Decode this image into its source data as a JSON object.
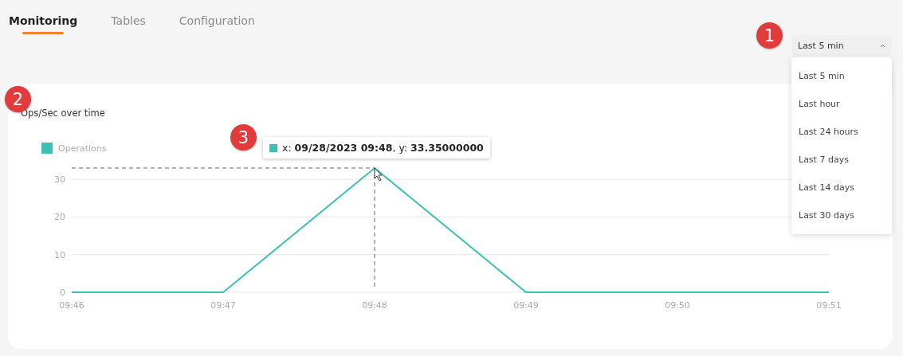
{
  "tabs": [
    {
      "label": "Monitoring",
      "selected": true
    },
    {
      "label": "Tables",
      "selected": false
    },
    {
      "label": "Configuration",
      "selected": false
    }
  ],
  "time_range": {
    "marker": "1",
    "value": "Last 5 min",
    "expanded": true,
    "options": [
      "Last 5 min",
      "Last hour",
      "Last 24 hours",
      "Last 7 days",
      "Last 14 days",
      "Last 30 days"
    ]
  },
  "card": {
    "marker": "2",
    "title": "Ops/Sec over time",
    "chart_data": {
      "type": "line",
      "categories": [
        "09:46",
        "09:47",
        "09:48",
        "09:49",
        "09:50",
        "09:51"
      ],
      "series": [
        {
          "name": "Operations",
          "color": "#3cc0b5",
          "values": [
            0,
            0,
            33,
            0,
            0,
            0
          ]
        }
      ],
      "ylim": [
        0,
        33
      ],
      "yticks": [
        0,
        10,
        20,
        30
      ],
      "grid": true,
      "ref_lines": [
        {
          "axis": "y",
          "value": 33
        },
        {
          "axis": "x",
          "value": "09:48"
        }
      ]
    },
    "tooltip": {
      "marker": "3",
      "text": "x: **09/28/2023 09:48**, y: **33.35000000**"
    }
  }
}
